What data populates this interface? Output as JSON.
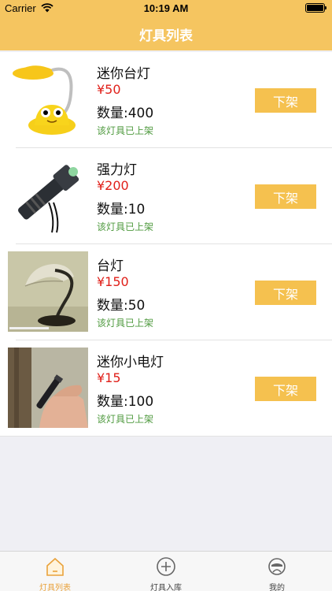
{
  "status_bar": {
    "carrier": "Carrier",
    "time": "10:19 AM",
    "battery_level": 1.0
  },
  "navbar": {
    "title": "灯具列表"
  },
  "items": [
    {
      "name": "迷你台灯",
      "price": "¥50",
      "quantity": "数量:400",
      "status": "该灯具已上架",
      "action": "下架",
      "image": "mini-desk-lamp"
    },
    {
      "name": "强力灯",
      "price": "¥200",
      "quantity": "数量:10",
      "status": "该灯具已上架",
      "action": "下架",
      "image": "flashlight"
    },
    {
      "name": "台灯",
      "price": "¥150",
      "quantity": "数量:50",
      "status": "该灯具已上架",
      "action": "下架",
      "image": "desk-lamp"
    },
    {
      "name": "迷你小电灯",
      "price": "¥15",
      "quantity": "数量:100",
      "status": "该灯具已上架",
      "action": "下架",
      "image": "mini-penlight"
    }
  ],
  "tabbar": {
    "tabs": [
      {
        "label": "灯具列表",
        "icon": "home-icon",
        "active": true
      },
      {
        "label": "灯具入库",
        "icon": "add-circle-icon",
        "active": false
      },
      {
        "label": "我的",
        "icon": "profile-icon",
        "active": false
      }
    ]
  },
  "colors": {
    "accent": "#f5c560",
    "button": "#f5c14f",
    "price": "#e0201a",
    "status": "#4f9a3f",
    "tab_active": "#e9a23b"
  }
}
